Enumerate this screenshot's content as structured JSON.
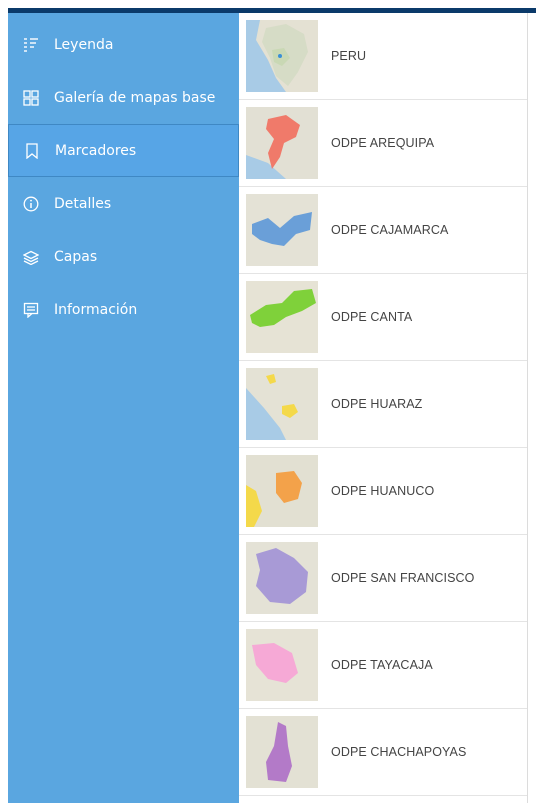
{
  "sidebar": {
    "items": [
      {
        "label": "Leyenda",
        "icon": "legend-icon"
      },
      {
        "label": "Galería de mapas base",
        "icon": "basemap-gallery-icon"
      },
      {
        "label": "Marcadores",
        "icon": "bookmark-icon",
        "active": true
      },
      {
        "label": "Detalles",
        "icon": "info-icon"
      },
      {
        "label": "Capas",
        "icon": "layers-icon"
      },
      {
        "label": "Información",
        "icon": "about-icon"
      }
    ]
  },
  "bookmarks": {
    "items": [
      {
        "label": "PERU",
        "color": "#3a8fd6"
      },
      {
        "label": "ODPE AREQUIPA",
        "color": "#f07a6a"
      },
      {
        "label": "ODPE CAJAMARCA",
        "color": "#6a9fd8"
      },
      {
        "label": "ODPE CANTA",
        "color": "#7fd13a"
      },
      {
        "label": "ODPE HUARAZ",
        "color": "#f4d94a"
      },
      {
        "label": "ODPE HUANUCO",
        "color": "#f3a24a"
      },
      {
        "label": "ODPE SAN FRANCISCO",
        "color": "#a89ad6"
      },
      {
        "label": "ODPE TAYACAJA",
        "color": "#f6a9d6"
      },
      {
        "label": "ODPE CHACHAPOYAS",
        "color": "#b37ac8"
      }
    ]
  },
  "colors": {
    "sidebar_bg": "#5aa6e0",
    "top_bar": "#0b3a6a"
  }
}
